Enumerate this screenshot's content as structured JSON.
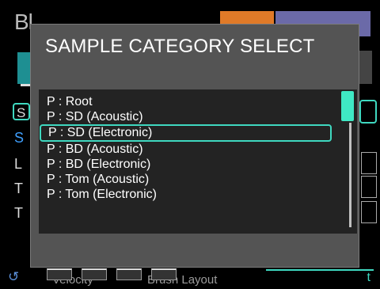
{
  "background": {
    "title": "Bl",
    "rows": [
      "S",
      "S",
      "L",
      "T",
      "T"
    ],
    "bottom": {
      "reload_icon": "↺",
      "labels": [
        "Velocity",
        "Brush Layout"
      ],
      "edit_tab": "t"
    }
  },
  "dialog": {
    "title": "SAMPLE CATEGORY SELECT",
    "items": [
      "P : Root",
      "P : SD (Acoustic)",
      "P : SD (Electronic)",
      "P : BD (Acoustic)",
      "P : BD (Electronic)",
      "P : Tom (Acoustic)",
      "P : Tom (Electronic)"
    ],
    "selected_index": 2
  },
  "colors": {
    "accent": "#3fd8c0",
    "orange_tab": "#e07a28",
    "purple_tab": "#6b6aa8",
    "dialog_bg": "#545454",
    "list_bg": "#232323"
  }
}
